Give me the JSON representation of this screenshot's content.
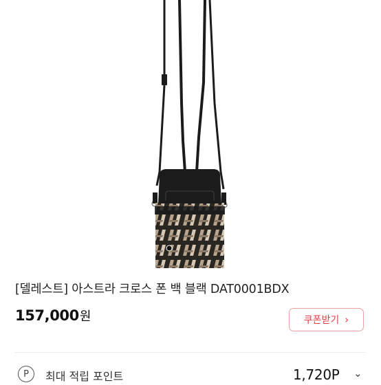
{
  "product": {
    "image_alt": "black crossbody phone bag",
    "title": "[델레스트] 아스트라 크로스 폰 백 블랙 DAT0001BDX",
    "price": "157,000",
    "price_unit": "원",
    "coupon_button_label": "쿠폰받기",
    "coupon_chevron": "›"
  },
  "points": {
    "icon_letter": "P",
    "label": "최대 적립 포인트",
    "value": "1,720P",
    "chevron": "⌄"
  },
  "colors": {
    "accent": "#e33b44",
    "accent_border": "#e8a0a4",
    "bag_black": "#1b1b1b",
    "pattern_beige": "#b8a48c"
  }
}
